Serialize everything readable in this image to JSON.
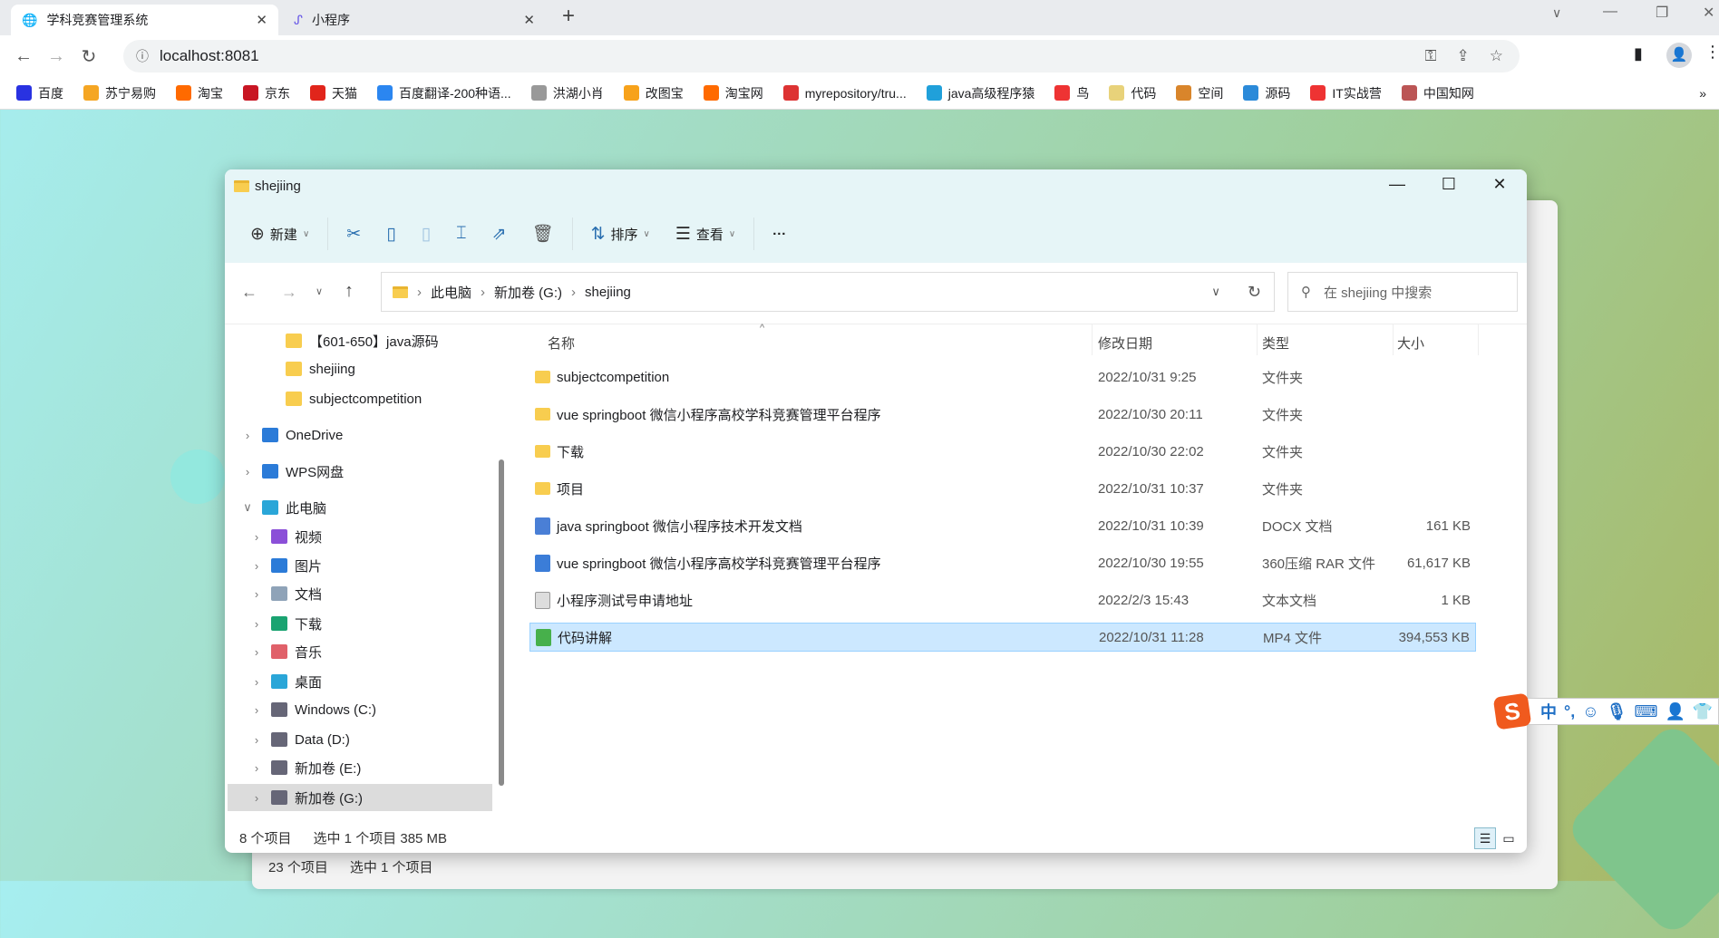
{
  "browser": {
    "tabs": [
      {
        "title": "学科竞赛管理系统",
        "active": true
      },
      {
        "title": "小程序",
        "active": false
      }
    ],
    "url": "localhost:8081",
    "bookmarks": [
      {
        "label": "百度",
        "color": "#2932e1"
      },
      {
        "label": "苏宁易购",
        "color": "#f5a623"
      },
      {
        "label": "淘宝",
        "color": "#ff6a00"
      },
      {
        "label": "京东",
        "color": "#c81623"
      },
      {
        "label": "天猫",
        "color": "#e1251b"
      },
      {
        "label": "百度翻译-200种语...",
        "color": "#2b86f0"
      },
      {
        "label": "洪湖小肖",
        "color": "#999"
      },
      {
        "label": "改图宝",
        "color": "#f7a21b"
      },
      {
        "label": "淘宝网",
        "color": "#ff6a00"
      },
      {
        "label": "myrepository/tru...",
        "color": "#d33"
      },
      {
        "label": "java高级程序猿",
        "color": "#20a0da"
      },
      {
        "label": "鸟",
        "color": "#e33"
      },
      {
        "label": "代码",
        "color": "#e8d27a"
      },
      {
        "label": "空间",
        "color": "#d9852b"
      },
      {
        "label": "源码",
        "color": "#2b8ad9"
      },
      {
        "label": "IT实战营",
        "color": "#e33"
      },
      {
        "label": "中国知网",
        "color": "#b55"
      }
    ],
    "more": "»"
  },
  "explorer": {
    "title": "shejiing",
    "commands": {
      "new": "新建",
      "sort": "排序",
      "view": "查看",
      "more": "···"
    },
    "breadcrumb": [
      "此电脑",
      "新加卷 (G:)",
      "shejiing"
    ],
    "search_placeholder": "在 shejiing 中搜索",
    "nav": [
      {
        "label": "【601-650】java源码",
        "level": 2,
        "icon": "folder"
      },
      {
        "label": "shejiing",
        "level": 2,
        "icon": "folder"
      },
      {
        "label": "subjectcompetition",
        "level": 2,
        "icon": "folder"
      },
      {
        "label": "OneDrive",
        "level": 0,
        "icon": "cloud"
      },
      {
        "label": "WPS网盘",
        "level": 0,
        "icon": "cloud"
      },
      {
        "label": "此电脑",
        "level": 0,
        "icon": "pc"
      },
      {
        "label": "视频",
        "level": 1,
        "icon": "video"
      },
      {
        "label": "图片",
        "level": 1,
        "icon": "pictures"
      },
      {
        "label": "文档",
        "level": 1,
        "icon": "documents"
      },
      {
        "label": "下载",
        "level": 1,
        "icon": "download"
      },
      {
        "label": "音乐",
        "level": 1,
        "icon": "music"
      },
      {
        "label": "桌面",
        "level": 1,
        "icon": "desktop"
      },
      {
        "label": "Windows (C:)",
        "level": 1,
        "icon": "drive"
      },
      {
        "label": "Data (D:)",
        "level": 1,
        "icon": "drive"
      },
      {
        "label": "新加卷 (E:)",
        "level": 1,
        "icon": "drive"
      },
      {
        "label": "新加卷 (G:)",
        "level": 1,
        "icon": "drive",
        "selected": true
      }
    ],
    "columns": {
      "name": "名称",
      "date": "修改日期",
      "type": "类型",
      "size": "大小"
    },
    "files": [
      {
        "name": "subjectcompetition",
        "date": "2022/10/31 9:25",
        "type": "文件夹",
        "size": "",
        "icon": "folder"
      },
      {
        "name": "vue springboot 微信小程序高校学科竞赛管理平台程序",
        "date": "2022/10/30 20:11",
        "type": "文件夹",
        "size": "",
        "icon": "folder"
      },
      {
        "name": "下载",
        "date": "2022/10/30 22:02",
        "type": "文件夹",
        "size": "",
        "icon": "folder"
      },
      {
        "name": "项目",
        "date": "2022/10/31 10:37",
        "type": "文件夹",
        "size": "",
        "icon": "folder"
      },
      {
        "name": "java springboot 微信小程序技术开发文档",
        "date": "2022/10/31 10:39",
        "type": "DOCX 文档",
        "size": "161 KB",
        "icon": "docx"
      },
      {
        "name": "vue springboot 微信小程序高校学科竞赛管理平台程序",
        "date": "2022/10/30 19:55",
        "type": "360压缩 RAR 文件",
        "size": "61,617 KB",
        "icon": "rar"
      },
      {
        "name": "小程序测试号申请地址",
        "date": "2022/2/3 15:43",
        "type": "文本文档",
        "size": "1 KB",
        "icon": "txt"
      },
      {
        "name": "代码讲解",
        "date": "2022/10/31 11:28",
        "type": "MP4 文件",
        "size": "394,553 KB",
        "icon": "mp4",
        "selected": true
      }
    ],
    "status": {
      "count": "8 个项目",
      "selection": "选中 1 个项目  385 MB"
    }
  },
  "back_window": {
    "status": {
      "count": "23 个项目",
      "selection": "选中 1 个项目"
    }
  },
  "ime": {
    "logo": "S",
    "mode": "中",
    "punct": "°,"
  }
}
